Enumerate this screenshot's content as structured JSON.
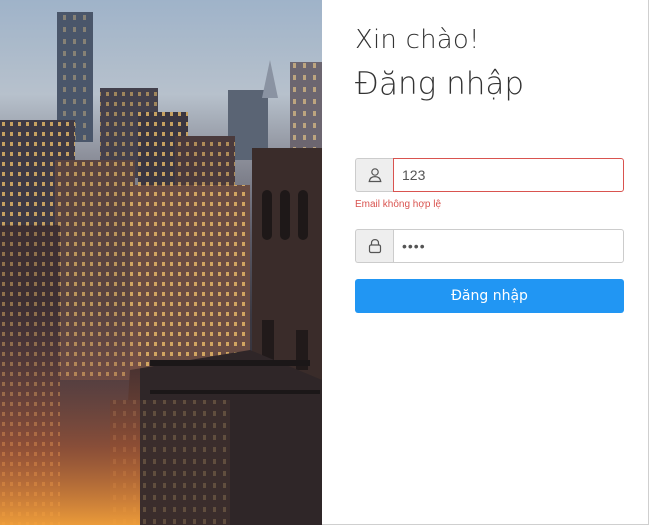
{
  "login": {
    "greeting": "Xin chào!",
    "title": "Đăng nhập",
    "email_value": "123",
    "email_error": "Email không hợp lệ",
    "password_value": "1234",
    "submit_label": "Đăng nhập"
  },
  "icons": {
    "email_addon": "user-icon",
    "password_addon": "lock-icon"
  },
  "colors": {
    "accent": "#2196f3",
    "error": "#d9534f"
  }
}
